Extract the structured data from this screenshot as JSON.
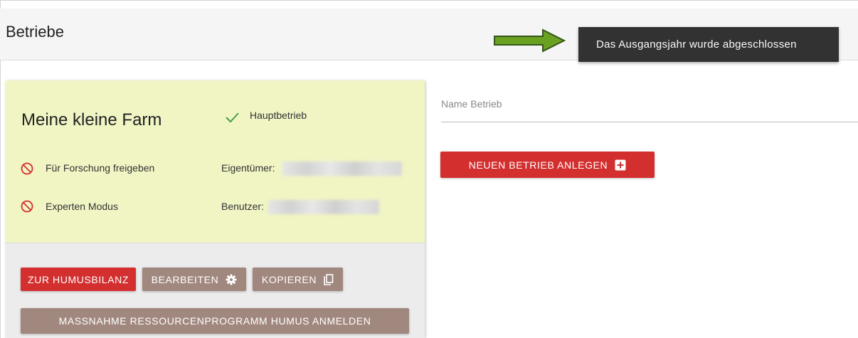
{
  "header": {
    "title": "Betriebe",
    "toast_message": "Das Ausgangsjahr wurde abgeschlossen"
  },
  "farm_card": {
    "name": "Meine kleine Farm",
    "main_status": "Hauptbetrieb",
    "options": [
      {
        "label": "Für Forschung freigeben",
        "icon": "ban-icon"
      },
      {
        "label": "Experten Modus",
        "icon": "ban-icon"
      }
    ],
    "owner_label": "Eigentümer:",
    "user_label": "Benutzer:",
    "buttons": {
      "humus": "ZUR HUMUSBILANZ",
      "edit": "BEARBEITEN",
      "copy": "KOPIEREN",
      "register": "MASSNAHME RESSOURCENPROGRAMM HUMUS ANMELDEN"
    }
  },
  "new_farm": {
    "name_placeholder": "Name Betrieb",
    "create_button": "NEUEN BETRIEB ANLEGEN"
  },
  "colors": {
    "primary_red": "#d32f2f",
    "secondary_brown": "#a1887f",
    "card_highlight": "#f1f5c4",
    "toast_bg": "#323232",
    "arrow_green": "#6aa121",
    "check_green": "#43a047"
  }
}
